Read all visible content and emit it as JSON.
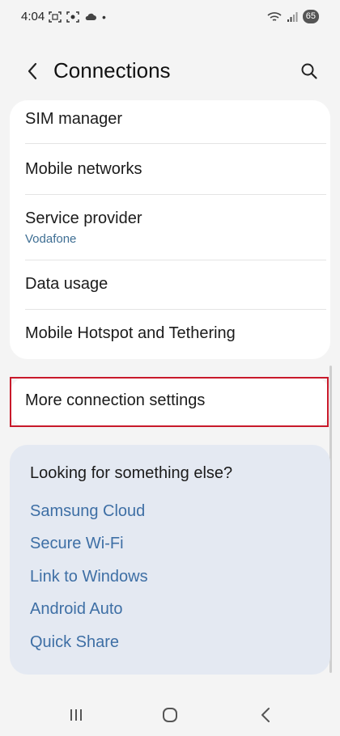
{
  "status_bar": {
    "time": "4:04",
    "battery": "65",
    "dot": "•"
  },
  "header": {
    "title": "Connections",
    "back_icon": "back-arrow-icon",
    "search_icon": "search-icon"
  },
  "main_list": {
    "items": [
      {
        "label": "SIM manager"
      },
      {
        "label": "Mobile networks"
      },
      {
        "label": "Service provider",
        "sublabel": "Vodafone"
      },
      {
        "label": "Data usage"
      },
      {
        "label": "Mobile Hotspot and Tethering"
      }
    ]
  },
  "more_settings": {
    "label": "More connection settings",
    "highlight_color": "#c8192a"
  },
  "suggestions": {
    "title": "Looking for something else?",
    "links": [
      "Samsung Cloud",
      "Secure Wi-Fi",
      "Link to Windows",
      "Android Auto",
      "Quick Share"
    ]
  },
  "colors": {
    "background": "#f4f4f4",
    "card": "#ffffff",
    "suggest_card": "#e4e9f2",
    "link": "#3e6fa5",
    "sublabel": "#3e6e93"
  }
}
